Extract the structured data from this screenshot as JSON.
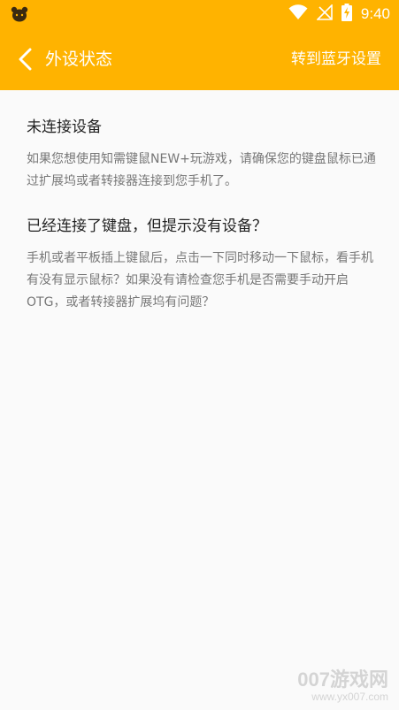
{
  "status_bar": {
    "time": "9:40",
    "icons": [
      "app-notification-bear-icon",
      "wifi-icon",
      "no-signal-icon",
      "battery-charging-icon"
    ],
    "color": "#ffb300"
  },
  "toolbar": {
    "back_icon": "chevron-left-icon",
    "title": "外设状态",
    "action_label": "转到蓝牙设置"
  },
  "sections": [
    {
      "heading": "未连接设备",
      "body": "如果您想使用知需键鼠NEW+玩游戏，请确保您的键盘鼠标已通过扩展坞或者转接器连接到您手机了。"
    },
    {
      "heading": "已经连接了键盘，但提示没有设备？",
      "body": "手机或者平板插上键鼠后，点击一下同时移动一下鼠标，看手机有没有显示鼠标？如果没有请检查您手机是否需要手动开启OTG，或者转接器扩展坞有问题？"
    }
  ],
  "watermark": {
    "logo": "007游戏网",
    "url": "www.yx007.com"
  },
  "colors": {
    "accent": "#ffb300",
    "heading": "#222222",
    "body": "#777777",
    "background": "#fafafa"
  }
}
